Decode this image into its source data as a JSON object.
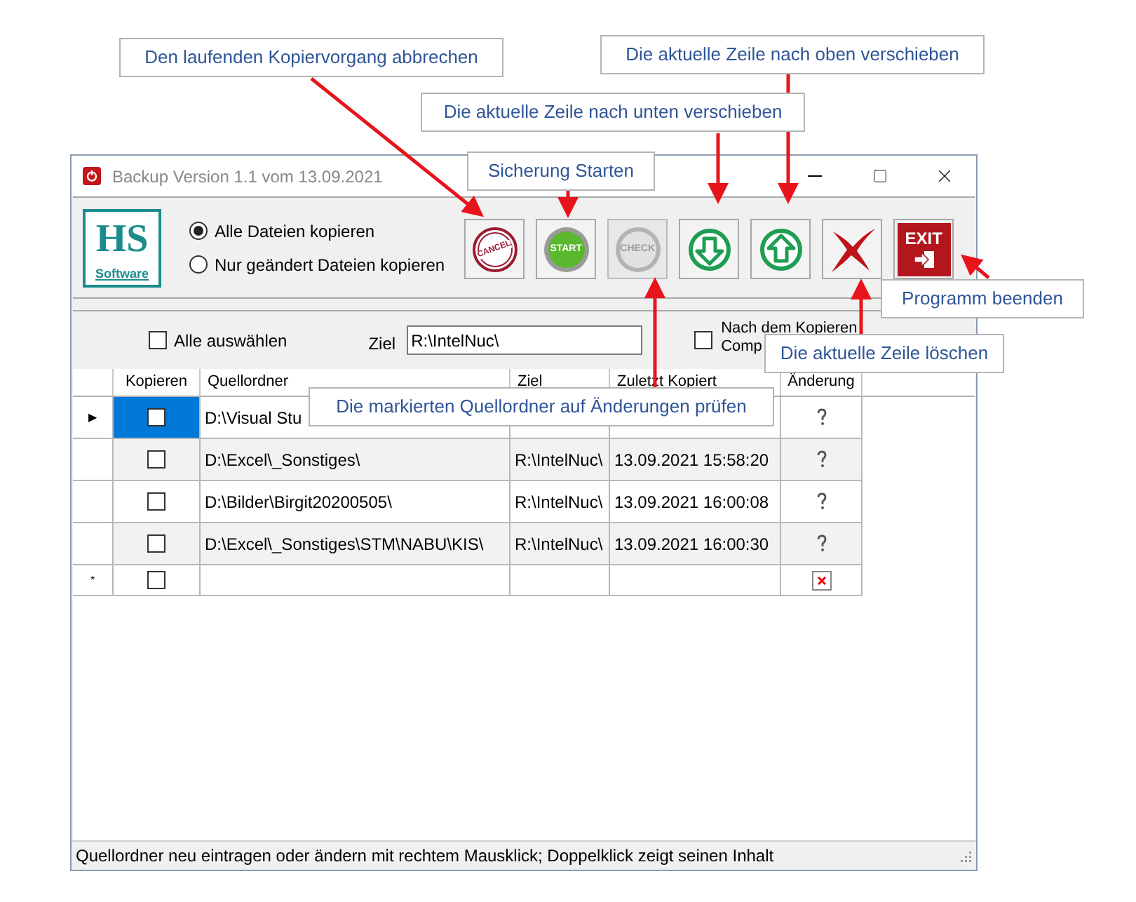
{
  "window": {
    "title": "Backup Version 1.1 vom 13.09.2021"
  },
  "logo": {
    "mark": "HS",
    "caption": "Software"
  },
  "options": [
    {
      "label": "Alle Dateien kopieren",
      "selected": true
    },
    {
      "label": "Nur geändert Dateien kopieren",
      "selected": false
    }
  ],
  "toolbar_buttons": [
    {
      "kind": "cancel",
      "label": "CANCEL",
      "disabled": false
    },
    {
      "kind": "start",
      "label": "START",
      "disabled": false
    },
    {
      "kind": "check",
      "label": "CHECK",
      "disabled": true
    },
    {
      "kind": "down",
      "disabled": false
    },
    {
      "kind": "up",
      "disabled": false
    },
    {
      "kind": "delete",
      "disabled": false
    },
    {
      "kind": "exit",
      "label": "EXIT",
      "disabled": false
    }
  ],
  "filter": {
    "select_all": {
      "label": "Alle auswählen",
      "checked": false
    },
    "target": {
      "label": "Ziel",
      "value": "R:\\IntelNuc\\"
    },
    "after_copy": {
      "label_lines": [
        "Nach dem Kopieren",
        "Comp"
      ],
      "checked": false
    }
  },
  "table": {
    "columns": [
      "Kopieren",
      "Quellordner",
      "Ziel",
      "Zuletzt Kopiert",
      "Änderung"
    ],
    "rows": [
      {
        "marker": "▶",
        "selected": true,
        "checked": false,
        "source": "D:\\Visual Stu",
        "target": "",
        "last_copied": "",
        "image_missing": false
      },
      {
        "selected": false,
        "checked": false,
        "source": "D:\\Excel\\_Sonstiges\\",
        "target": "R:\\IntelNuc\\",
        "last_copied": "13.09.2021 15:58:20",
        "image_missing": false
      },
      {
        "selected": false,
        "checked": false,
        "source": "D:\\Bilder\\Birgit20200505\\",
        "target": "R:\\IntelNuc\\",
        "last_copied": "13.09.2021 16:00:08",
        "image_missing": false
      },
      {
        "selected": false,
        "checked": false,
        "source": "D:\\Excel\\_Sonstiges\\STM\\NABU\\KIS\\",
        "target": "R:\\IntelNuc\\",
        "last_copied": "13.09.2021 16:00:30",
        "image_missing": false
      },
      {
        "marker": "*",
        "selected": false,
        "checked": false,
        "source": "",
        "target": "",
        "last_copied": "",
        "image_missing": true
      }
    ]
  },
  "status_bar": "Quellordner neu eintragen oder ändern mit rechtem Mausklick; Doppelklick zeigt seinen Inhalt",
  "callouts": [
    "Den laufenden Kopiervorgang abbrechen",
    "Die aktuelle Zeile nach oben verschieben",
    "Die aktuelle Zeile nach unten verschieben",
    "Sicherung Starten",
    "Programm beenden",
    "Die aktuelle Zeile löschen",
    "Die markierten Quellordner auf Änderungen prüfen"
  ]
}
